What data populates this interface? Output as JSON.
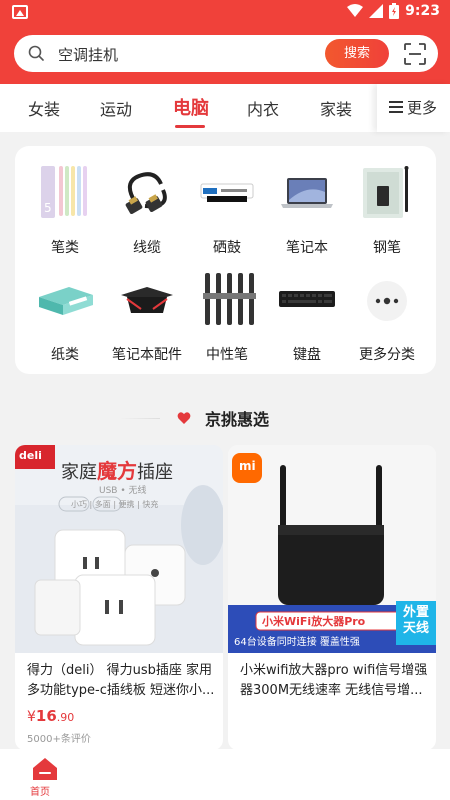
{
  "status": {
    "time": "9:23"
  },
  "search": {
    "placeholder": "空调挂机",
    "button": "搜索"
  },
  "tabs": [
    "女装",
    "运动",
    "电脑",
    "内衣",
    "家装"
  ],
  "more_label": "更多",
  "categories": [
    "笔类",
    "线缆",
    "硒鼓",
    "笔记本",
    "钢笔",
    "纸类",
    "笔记本配件",
    "中性笔",
    "键盘",
    "更多分类"
  ],
  "section": {
    "title": "京挑惠选"
  },
  "products": [
    {
      "image_text": {
        "brand": "deli",
        "headline_a": "家庭",
        "headline_b": "魔方",
        "headline_c": "插座",
        "sub": "USB • 无线",
        "features": "小巧 | 多面 | 便携 | 快充"
      },
      "title": "得力（deli） 得力usb插座 家用多功能type-c插线板 短迷你小...",
      "price_symbol": "¥",
      "price_int": "16",
      "price_dec": ".90",
      "reviews": "5000+条评价"
    },
    {
      "image_text": {
        "brand": "mi",
        "banner": "小米WiFi放大器Pro",
        "sub": "64台设备同时连接 覆盖性强",
        "badge": "外置天线"
      },
      "title": "小米wifi放大器pro wifi信号增强器300M无线速率 无线信号增..."
    }
  ],
  "bottom": {
    "home": "首页"
  },
  "colors": {
    "brand_red": "#f0413a",
    "accent": "#e4393c"
  }
}
